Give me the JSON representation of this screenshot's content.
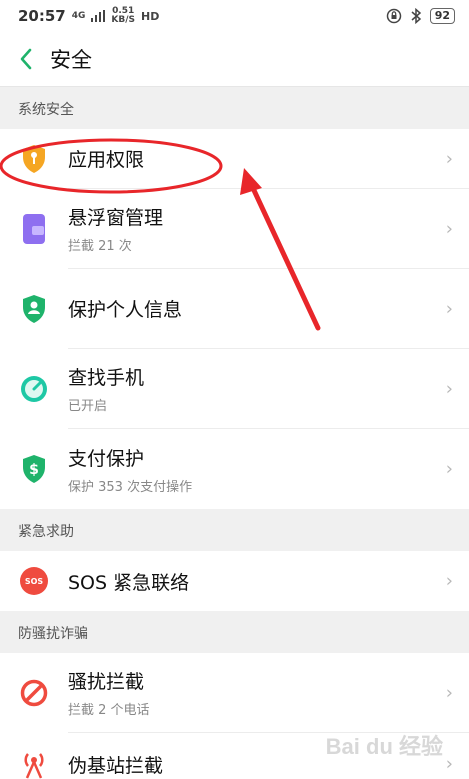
{
  "status_bar": {
    "time": "20:57",
    "signal": "4G",
    "speed_value": "0.51",
    "speed_unit": "KB/S",
    "hd": "HD",
    "battery": "92"
  },
  "header": {
    "title": "安全"
  },
  "sections": [
    {
      "label": "系统安全",
      "items": [
        {
          "title": "应用权限",
          "subtitle": ""
        },
        {
          "title": "悬浮窗管理",
          "subtitle": "拦截 21 次"
        },
        {
          "title": "保护个人信息",
          "subtitle": ""
        },
        {
          "title": "查找手机",
          "subtitle": "已开启"
        },
        {
          "title": "支付保护",
          "subtitle": "保护 353 次支付操作"
        }
      ]
    },
    {
      "label": "紧急求助",
      "items": [
        {
          "title": "SOS 紧急联络",
          "subtitle": "",
          "icon_text": "SOS"
        }
      ]
    },
    {
      "label": "防骚扰诈骗",
      "items": [
        {
          "title": "骚扰拦截",
          "subtitle": "拦截 2 个电话"
        },
        {
          "title": "伪基站拦截",
          "subtitle": ""
        }
      ]
    }
  ],
  "chevron": "›",
  "watermark": "Bai du 经验",
  "colors": {
    "annotation_red": "#e8262a",
    "accent_green": "#1fb36b"
  }
}
